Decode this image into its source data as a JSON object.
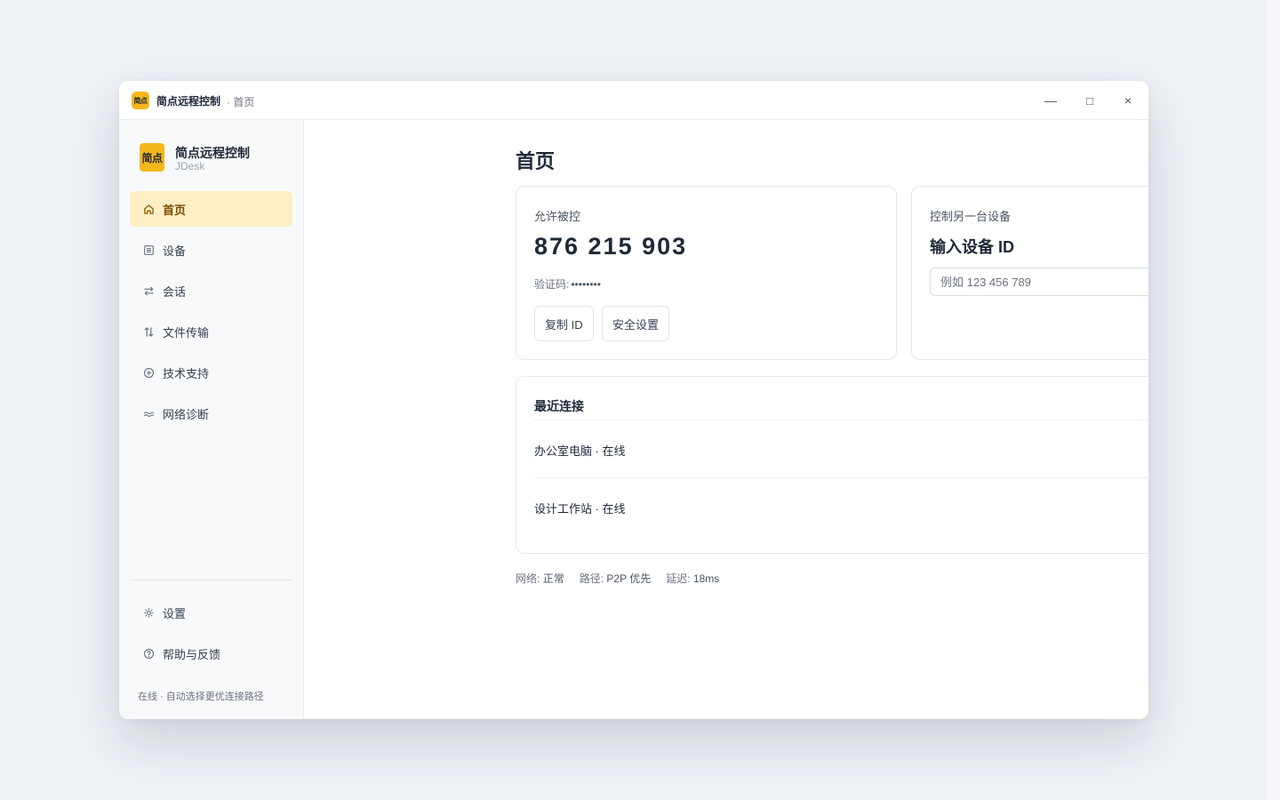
{
  "titlebar": {
    "logo_text": "简点",
    "app_name": "简点远程控制",
    "breadcrumb": "· 首页",
    "minimize": "—",
    "maximize": "□",
    "close": "×"
  },
  "sidebar": {
    "logo_text": "简点",
    "brand_name": "简点远程控制",
    "brand_sub": "JDesk",
    "items": [
      {
        "label": "首页",
        "icon": "home-icon",
        "active": true
      },
      {
        "label": "设备",
        "icon": "list-icon",
        "active": false
      },
      {
        "label": "会话",
        "icon": "swap-icon",
        "active": false
      },
      {
        "label": "文件传输",
        "icon": "transfer-icon",
        "active": false
      },
      {
        "label": "技术支持",
        "icon": "plus-circle-icon",
        "active": false
      },
      {
        "label": "网络诊断",
        "icon": "wave-icon",
        "active": false
      }
    ],
    "bottom_items": [
      {
        "label": "设置",
        "icon": "gear-icon"
      },
      {
        "label": "帮助与反馈",
        "icon": "help-icon"
      }
    ],
    "status": "在线 · 自动选择更优连接路径"
  },
  "main": {
    "title": "首页",
    "allow": {
      "label": "允许被控",
      "device_id": "876 215 903",
      "verify_label": "验证码:",
      "verify_code": "••••••••",
      "copy_button": "复制 ID",
      "security_button": "安全设置"
    },
    "control": {
      "label": "控制另一台设备",
      "title": "输入设备 ID",
      "input_placeholder": "例如 123 456 789",
      "input_value": ""
    },
    "recent": {
      "title": "最近连接",
      "rows": [
        {
          "text": "办公室电脑 · 在线"
        },
        {
          "text": "设计工作站 · 在线"
        }
      ]
    },
    "network": {
      "network_label": "网络:",
      "network_value": "正常",
      "route_label": "路径:",
      "route_value": "P2P 优先",
      "latency_label": "延迟:",
      "latency_value": "18ms"
    }
  },
  "colors": {
    "accent": "#f5b81c",
    "active_bg": "#fdefc3",
    "active_text": "#7c4a03",
    "background": "#eef1f6"
  }
}
